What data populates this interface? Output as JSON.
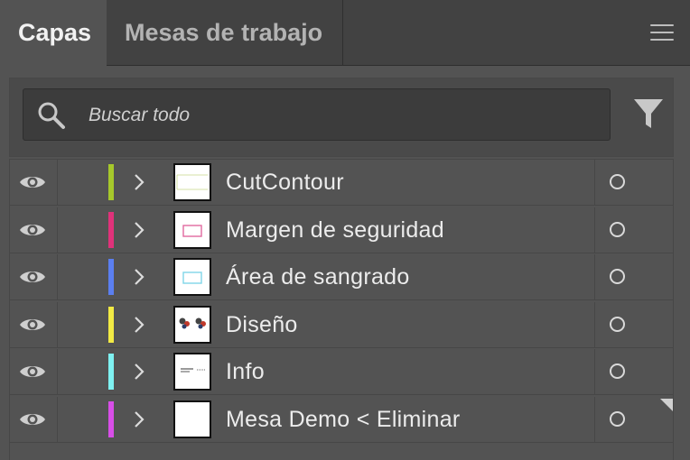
{
  "tabs": [
    {
      "label": "Capas",
      "active": true
    },
    {
      "label": "Mesas de trabajo",
      "active": false
    }
  ],
  "search": {
    "placeholder": "Buscar todo",
    "value": ""
  },
  "icons": {
    "panel_menu": "hamburger-menu-icon",
    "search": "search-icon",
    "filter": "filter-icon",
    "visibility": "eye-icon",
    "expand": "chevron-right-icon",
    "target": "target-circle-icon"
  },
  "layers": [
    {
      "name": "CutContour",
      "color": "#a6c82b",
      "thumb": "cutcontour"
    },
    {
      "name": "Margen de seguridad",
      "color": "#e0327a",
      "thumb": "pink-rect"
    },
    {
      "name": "Área de sangrado",
      "color": "#5b7ff0",
      "thumb": "cyan-rect"
    },
    {
      "name": "Diseño",
      "color": "#f2ea44",
      "thumb": "design"
    },
    {
      "name": "Info",
      "color": "#7ff2f2",
      "thumb": "info"
    },
    {
      "name": "Mesa Demo < Eliminar",
      "color": "#d84ee8",
      "thumb": "blank"
    }
  ]
}
